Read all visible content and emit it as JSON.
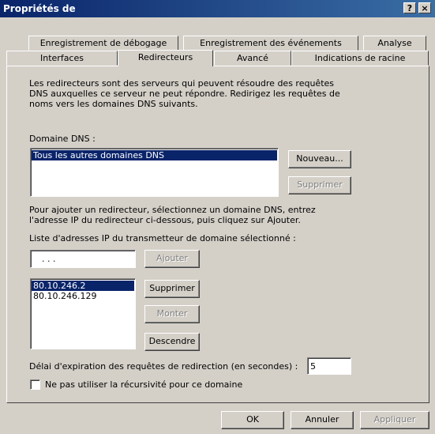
{
  "window": {
    "title": "Propriétés de",
    "help_btn": "?",
    "close_btn": "×"
  },
  "tabs_back": [
    "Enregistrement de débogage",
    "Enregistrement des événements",
    "Analyse"
  ],
  "tabs_front": [
    "Interfaces",
    "Redirecteurs",
    "Avancé",
    "Indications de racine"
  ],
  "intro": [
    "Les redirecteurs sont des serveurs qui peuvent résoudre des requêtes",
    "DNS auxquelles ce serveur ne peut répondre. Redirigez les requêtes de",
    "noms vers les domaines DNS suivants."
  ],
  "dns_domain": {
    "label": "Domaine DNS :",
    "items": [
      "Tous les autres domaines DNS"
    ],
    "new_btn": "Nouveau...",
    "delete_btn": "Supprimer"
  },
  "instructions": [
    "Pour ajouter un redirecteur, sélectionnez un domaine DNS, entrez",
    "l'adresse IP du redirecteur ci-dessous, puis cliquez sur Ajouter."
  ],
  "ip_list": {
    "label": "Liste d'adresses IP du transmetteur de domaine sélectionné :",
    "ip_placeholder": ".       .       .",
    "add_btn": "Ajouter",
    "items": [
      "80.10.246.2",
      "80.10.246.129"
    ],
    "delete_btn": "Supprimer",
    "up_btn": "Monter",
    "down_btn": "Descendre"
  },
  "timeout": {
    "label": "Délai d'expiration des requêtes de redirection (en secondes) :",
    "value": "5"
  },
  "recursion": {
    "label": "Ne pas utiliser la récursivité pour ce domaine",
    "checked": false
  },
  "footer": {
    "ok": "OK",
    "cancel": "Annuler",
    "apply": "Appliquer"
  }
}
